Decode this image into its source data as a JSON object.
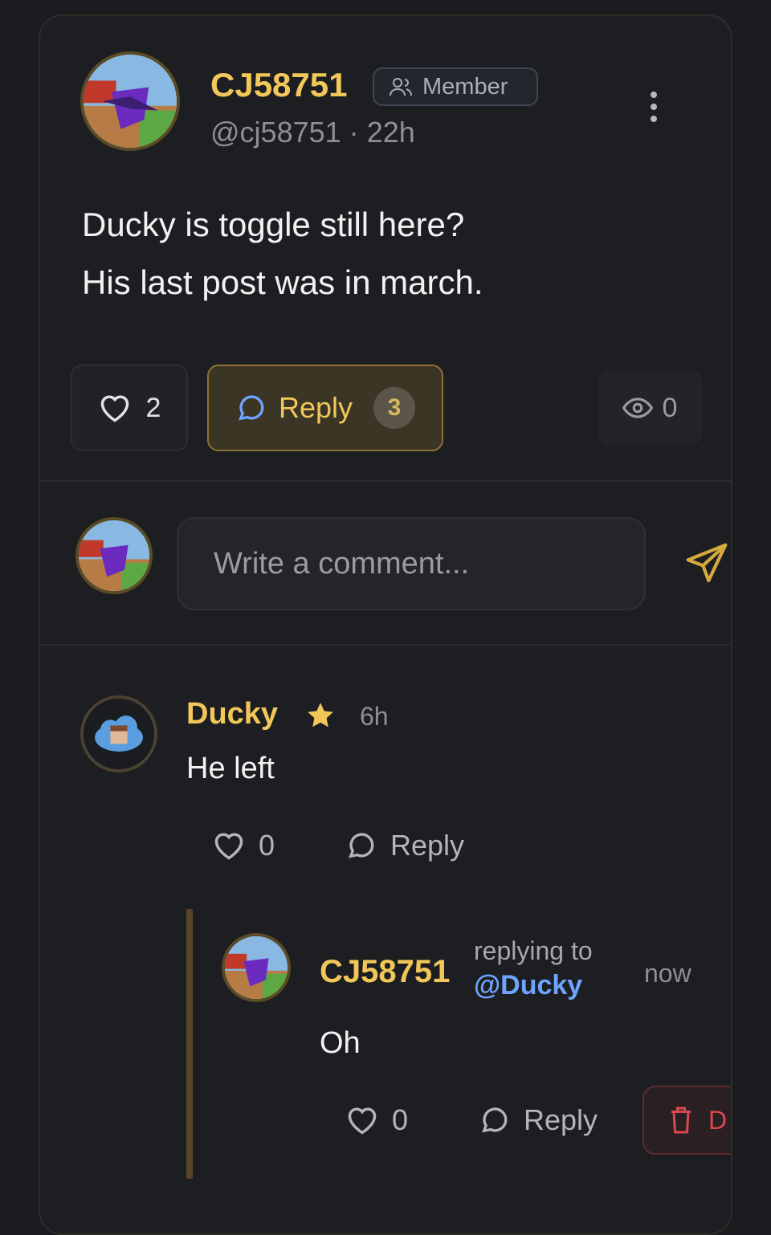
{
  "post": {
    "author": "CJ58751",
    "handle": "@cj58751",
    "separator": "·",
    "time": "22h",
    "badge": "Member",
    "text_line1": "Ducky is toggle still here?",
    "text_line2": "His last post was in march.",
    "likes": "2",
    "reply_label": "Reply",
    "reply_count": "3",
    "views": "0"
  },
  "composer": {
    "placeholder": "Write a comment..."
  },
  "comments": [
    {
      "author": "Ducky",
      "time": "6h",
      "text": "He left",
      "likes": "0",
      "reply_label": "Reply"
    }
  ],
  "reply": {
    "author": "CJ58751",
    "replying_to_label": "replying to",
    "replying_to": "@Ducky",
    "time": "now",
    "text": "Oh",
    "likes": "0",
    "reply_label": "Reply",
    "delete_label": "D"
  },
  "colors": {
    "accent": "#f1c75a",
    "mention": "#6ea4ff",
    "danger": "#d8484f"
  }
}
